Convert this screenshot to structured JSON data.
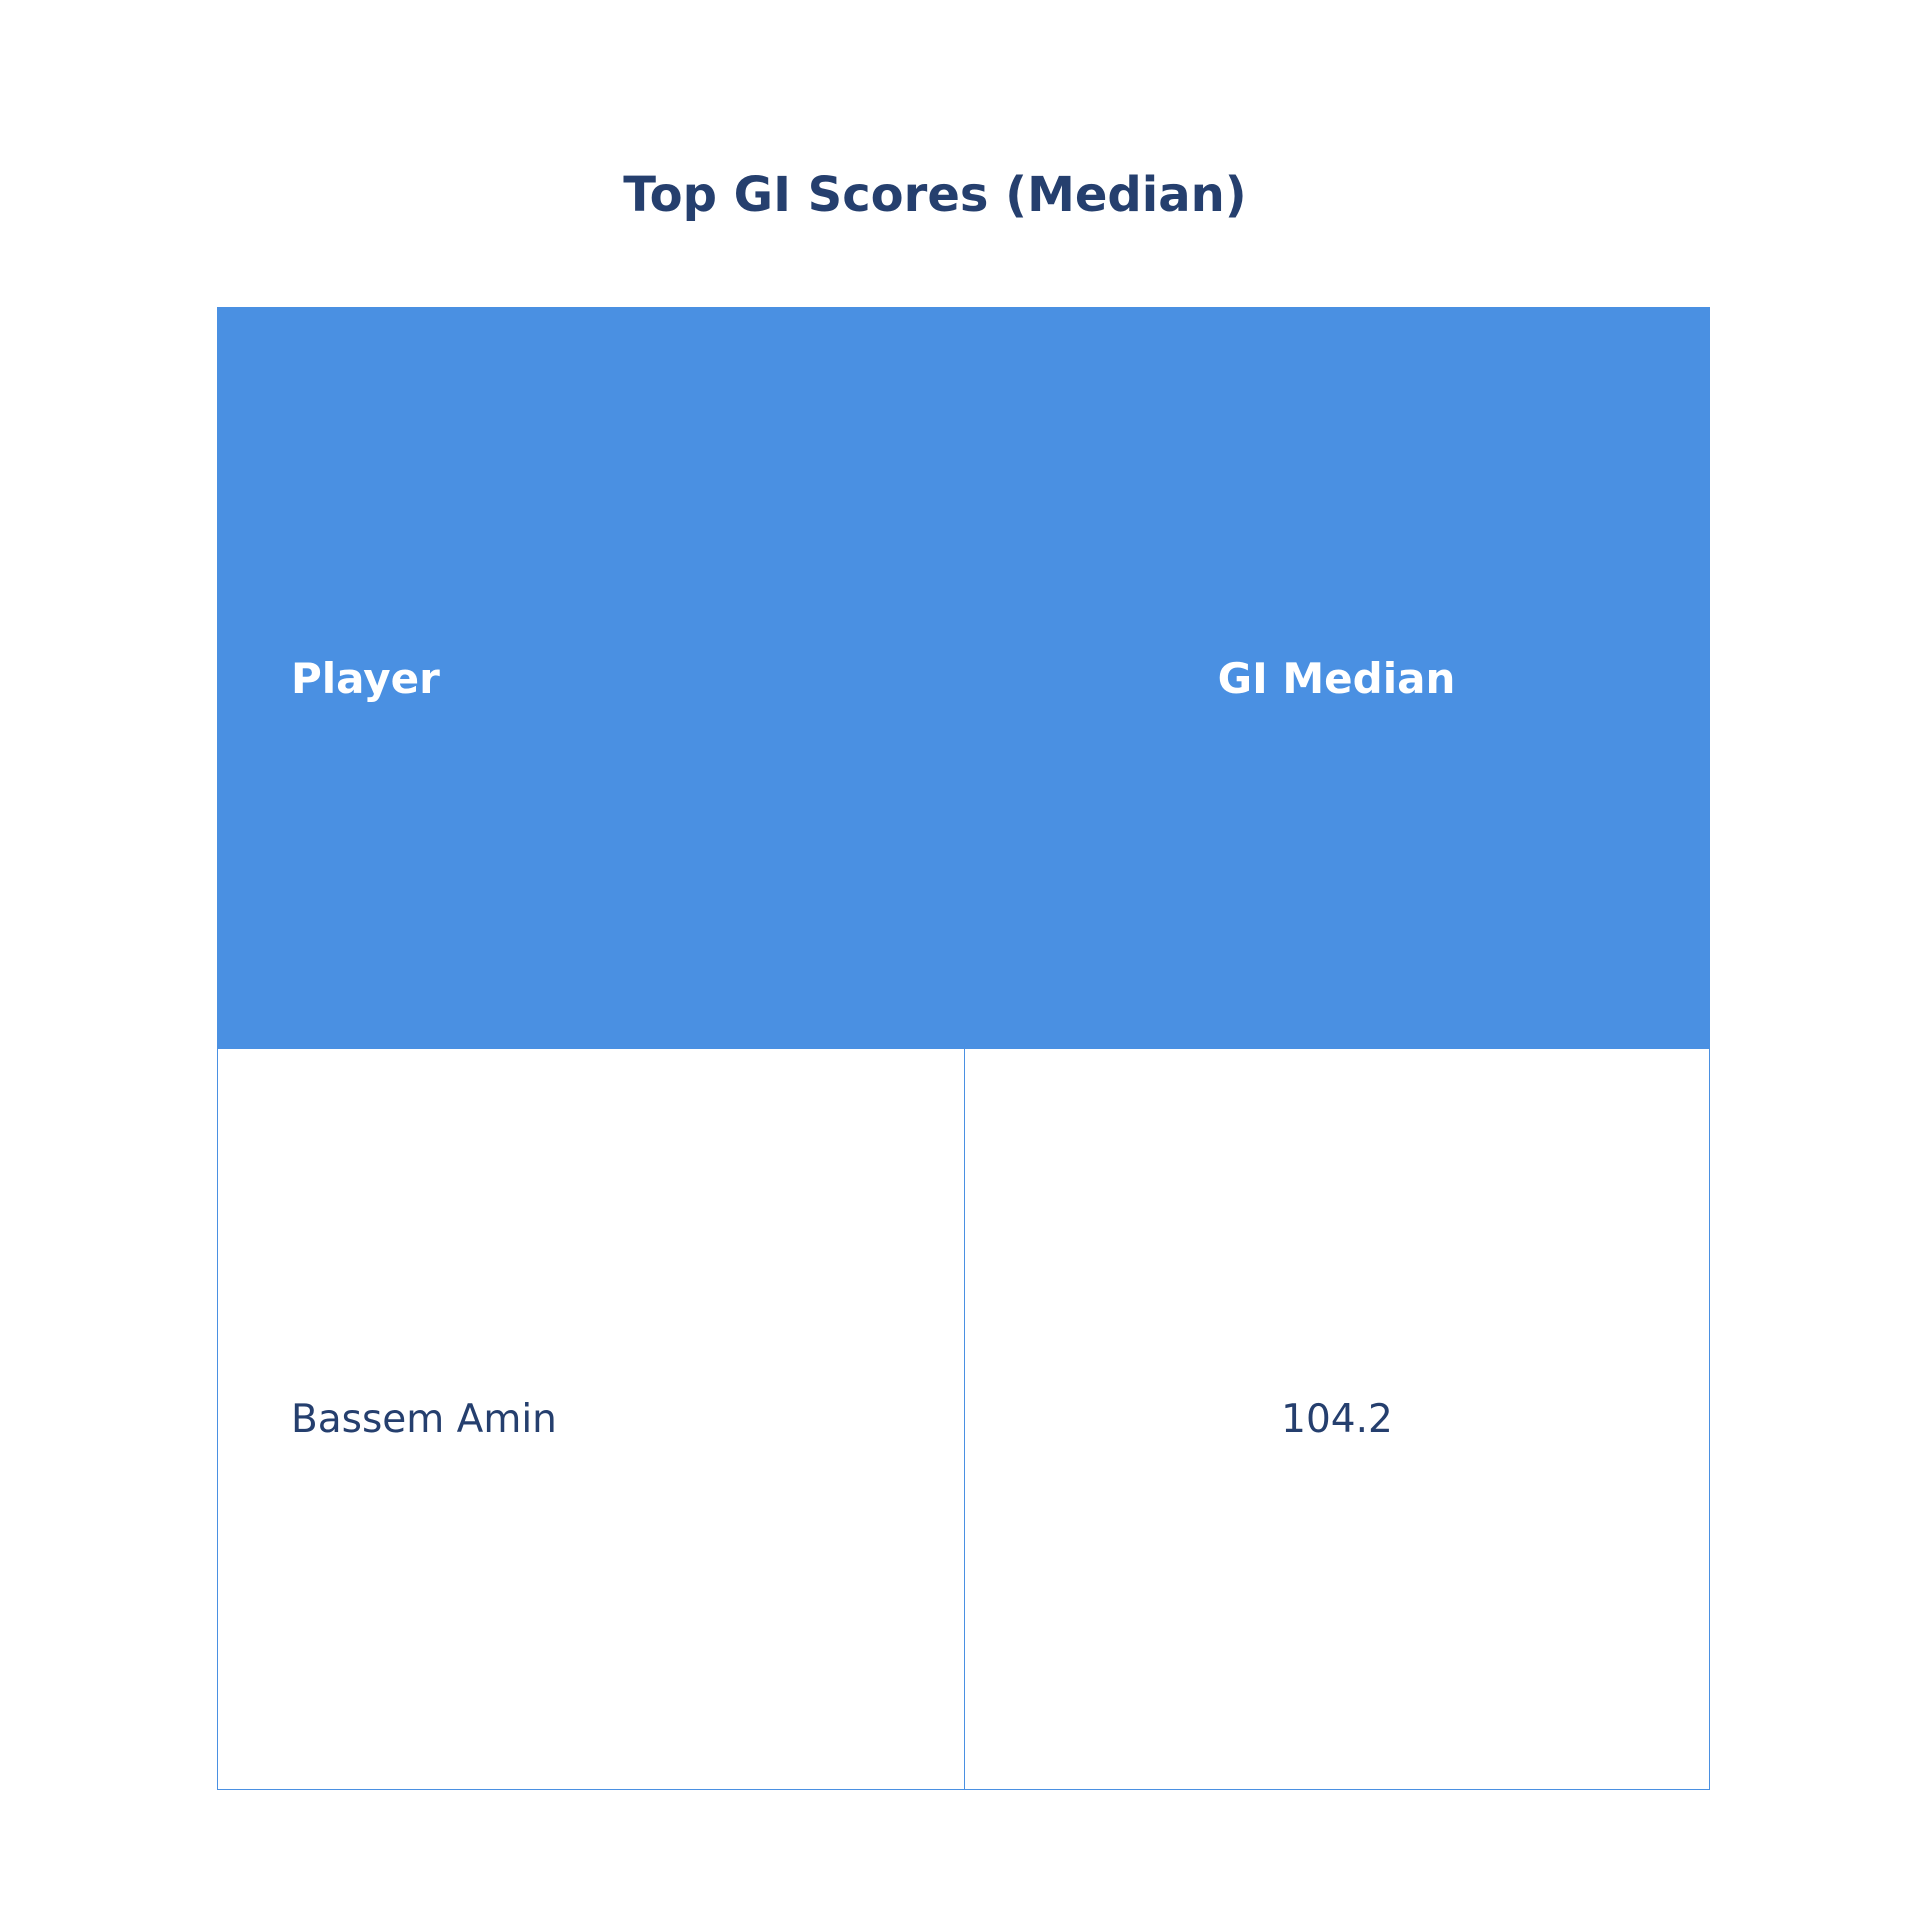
{
  "chart_data": {
    "type": "table",
    "title": "Top GI Scores (Median)",
    "columns": [
      "Player",
      "GI Median"
    ],
    "rows": [
      [
        "Bassem Amin",
        "104.2"
      ]
    ]
  },
  "colors": {
    "header_background": "#4A90E2",
    "header_text": "#FFFFFF",
    "body_text": "#253F6E",
    "title_text": "#253F6E",
    "border": "#4A90E2"
  }
}
